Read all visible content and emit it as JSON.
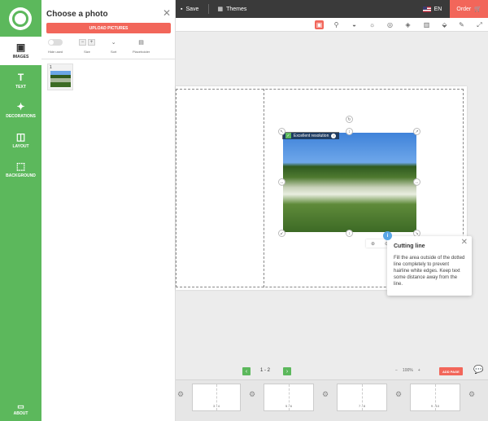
{
  "topbar": {
    "save_label": "Save",
    "themes_label": "Themes",
    "language": "EN",
    "order_label": "Order"
  },
  "sidebar": {
    "items": [
      {
        "label": "IMAGES",
        "icon": "images-icon"
      },
      {
        "label": "TEXT",
        "icon": "text-icon"
      },
      {
        "label": "DECORATIONS",
        "icon": "decorations-icon"
      },
      {
        "label": "LAYOUT",
        "icon": "layout-icon"
      },
      {
        "label": "BACKGROUND",
        "icon": "background-icon"
      }
    ],
    "about_label": "ABOUT"
  },
  "panel": {
    "title": "Choose a photo",
    "upload_label": "UPLOAD PICTURES",
    "options": {
      "hide_used": "Hide used",
      "size": "Size",
      "sort": "Sort",
      "placeholder": "Placeholder"
    },
    "thumbnails": [
      {
        "number": "1"
      }
    ]
  },
  "canvas": {
    "resolution_badge": "Excellent resolution"
  },
  "tooltip": {
    "title": "Cutting line",
    "text": "Fill the area outside of the dotted line completely to prevent hairline white edges. Keep text some distance away from the line."
  },
  "pagenav": {
    "page_label": "1 - 2",
    "zoom_level": "100%",
    "add_page_label": "ADD PAGE"
  },
  "strip": {
    "spreads": [
      "3 - 4",
      "5 - 6",
      "7 - 8",
      "9 - 10"
    ]
  },
  "colors": {
    "brand_green": "#5cb85c",
    "accent_red": "#f2665a",
    "info_blue": "#5aa7e6"
  }
}
